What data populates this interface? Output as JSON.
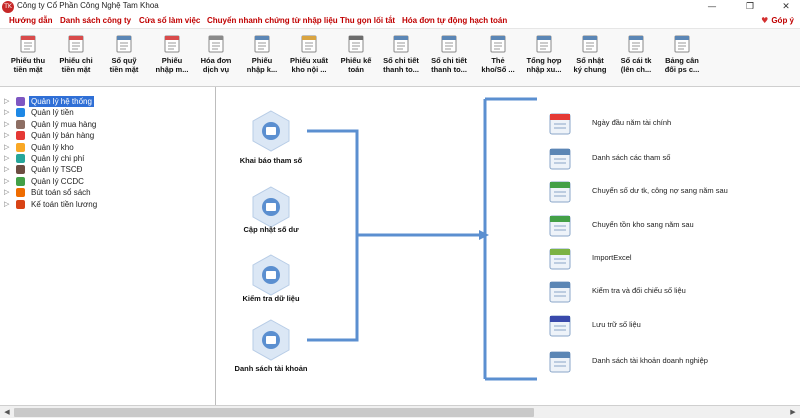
{
  "window": {
    "app_icon_text": "TK",
    "title": "Công ty Cổ Phần Công Nghệ Tam Khoa",
    "minimize_glyph": "—",
    "restore_glyph": "❐",
    "close_glyph": "✕"
  },
  "menu": {
    "items": [
      "Hướng dẫn",
      "Danh sách công ty",
      "Cửa sổ làm việc",
      "Chuyển nhanh chứng từ nhập liệu",
      "Thu gọn lối tắt",
      "Hóa đơn tự động hạch toán"
    ],
    "feedback_label": "Góp ý",
    "feedback_glyph": "♥"
  },
  "toolbar": {
    "items": [
      {
        "label": "Phiếu thu\ntiền mặt",
        "icon": "receipt-icon",
        "color": "#d84b4b"
      },
      {
        "label": "Phiếu chi\ntiền mặt",
        "icon": "payment-voucher-icon",
        "color": "#d84b4b"
      },
      {
        "label": "Sổ quỹ\ntiền mặt",
        "icon": "cash-book-icon",
        "color": "#5b86b5"
      },
      {
        "label": "Phiếu\nnhập m...",
        "icon": "import-voucher-icon",
        "color": "#d84b4b"
      },
      {
        "label": "Hóa đơn\ndịch vụ",
        "icon": "invoice-icon",
        "color": "#8a8a8a"
      },
      {
        "label": "Phiếu\nnhập k...",
        "icon": "stock-in-icon",
        "color": "#5b86b5"
      },
      {
        "label": "Phiếu xuất\nkho nội ...",
        "icon": "stock-out-icon",
        "color": "#d9a441"
      },
      {
        "label": "Phiếu kế\ntoán",
        "icon": "journal-voucher-icon",
        "color": "#6d6d6d"
      },
      {
        "label": "Sổ chi tiết\nthanh to...",
        "icon": "ledger-detail-icon",
        "color": "#5b86b5"
      },
      {
        "label": "Sổ chi tiết\nthanh to...",
        "icon": "ledger-detail-icon",
        "color": "#5b86b5"
      },
      {
        "label": "Thẻ\nkho/Sổ ...",
        "icon": "stock-card-icon",
        "color": "#5b86b5"
      },
      {
        "label": "Tổng hợp\nnhập xu...",
        "icon": "summary-icon",
        "color": "#5b86b5"
      },
      {
        "label": "Sổ nhật\nký chung",
        "icon": "general-journal-icon",
        "color": "#5b86b5"
      },
      {
        "label": "Sổ cái tk\n(lên ch...",
        "icon": "general-ledger-icon",
        "color": "#5b86b5"
      },
      {
        "label": "Bảng cân\nđối ps c...",
        "icon": "balance-sheet-icon",
        "color": "#5b86b5"
      }
    ]
  },
  "sidebar": {
    "items": [
      {
        "label": "Quản lý hệ thống",
        "icon": "system-icon",
        "color": "#7e57c2",
        "selected": true
      },
      {
        "label": "Quản lý tiền",
        "icon": "money-icon",
        "color": "#1e88e5"
      },
      {
        "label": "Quản lý mua hàng",
        "icon": "purchase-icon",
        "color": "#8d6e63"
      },
      {
        "label": "Quản lý bán hàng",
        "icon": "sales-icon",
        "color": "#e53935"
      },
      {
        "label": "Quản lý kho",
        "icon": "warehouse-icon",
        "color": "#f9a825"
      },
      {
        "label": "Quản lý chi phí",
        "icon": "expense-icon",
        "color": "#26a69a"
      },
      {
        "label": "Quản lý TSCĐ",
        "icon": "fixed-asset-icon",
        "color": "#6d4c41"
      },
      {
        "label": "Quản lý CCDC",
        "icon": "tools-icon",
        "color": "#43a047"
      },
      {
        "label": "Bút toán  sổ sách",
        "icon": "pen-icon",
        "color": "#ef6c00"
      },
      {
        "label": "Kế toán tiền lương",
        "icon": "payroll-icon",
        "color": "#d84315"
      }
    ],
    "expander_glyph": "▷"
  },
  "main": {
    "left_steps": [
      {
        "label": "Khai báo tham số",
        "icon": "users-settings-icon"
      },
      {
        "label": "Cập nhật số dư",
        "icon": "balance-update-icon"
      },
      {
        "label": "Kiểm tra dữ liệu",
        "icon": "folder-check-icon"
      },
      {
        "label": "Danh sách tài khoản",
        "icon": "account-list-icon"
      }
    ],
    "right_items": [
      {
        "label": "Ngày đầu năm tài chính",
        "icon": "calendar-icon"
      },
      {
        "label": "Danh sách các tham số",
        "icon": "parameters-icon"
      },
      {
        "label": "Chuyển số dư tk, công nợ sang năm sau",
        "icon": "transfer-balance-icon"
      },
      {
        "label": "Chuyển tồn kho sang năm sau",
        "icon": "transfer-stock-icon"
      },
      {
        "label": "ImportExcel",
        "icon": "excel-import-icon"
      },
      {
        "label": "Kiểm tra và đối chiếu số liệu",
        "icon": "reconcile-icon"
      },
      {
        "label": "Lưu trữ số liệu",
        "icon": "archive-icon"
      },
      {
        "label": "Danh sách tài khoản doanh nghiệp",
        "icon": "document-list-icon"
      }
    ]
  },
  "scrollbar": {
    "left_glyph": "◀",
    "right_glyph": "▶"
  },
  "colors": {
    "accent": "#c00000",
    "hex_fill": "#dbe7f5",
    "flow_line": "#5b8fd0",
    "selection": "#2f6fd6"
  }
}
